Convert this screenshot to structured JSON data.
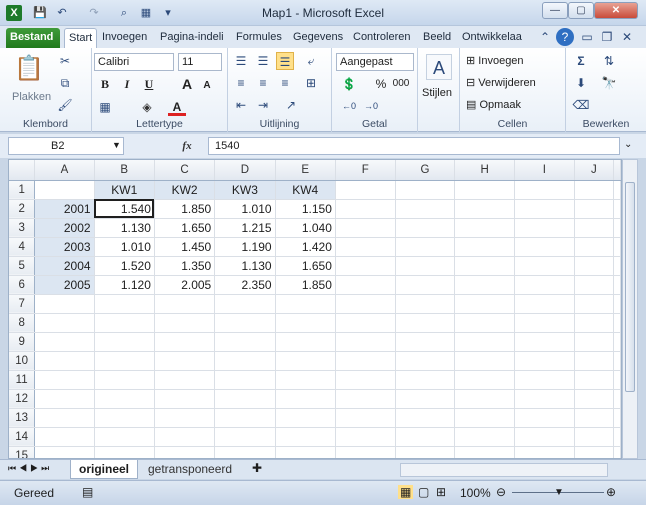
{
  "window": {
    "title": "Map1 - Microsoft Excel"
  },
  "qat": {
    "save": "💾",
    "undo": "↶",
    "redo": "↷"
  },
  "tabs": [
    "Bestand",
    "Start",
    "Invoegen",
    "Pagina-indeli",
    "Formules",
    "Gegevens",
    "Controleren",
    "Beeld",
    "Ontwikkelaa"
  ],
  "ribbon": {
    "clipboard": {
      "paste": "Plakken",
      "label": "Klembord"
    },
    "font": {
      "name": "Calibri",
      "size": "11",
      "label": "Lettertype",
      "bold": "B",
      "italic": "I",
      "underline": "U",
      "grow": "A",
      "shrink": "A"
    },
    "alignment": {
      "label": "Uitlijning"
    },
    "number": {
      "format": "Aangepast",
      "percent": "%",
      "thousands": "000",
      "label": "Getal"
    },
    "styles": {
      "label": "Stijlen"
    },
    "cells": {
      "insert": "Invoegen",
      "delete": "Verwijderen",
      "format": "Opmaak",
      "label": "Cellen"
    },
    "editing": {
      "label": "Bewerken"
    }
  },
  "formula_bar": {
    "name_box": "B2",
    "fx": "fx",
    "value": "1540"
  },
  "grid": {
    "columns": [
      "A",
      "B",
      "C",
      "D",
      "E",
      "F",
      "G",
      "H",
      "I",
      "J"
    ],
    "rows": [
      [
        "",
        "KW1",
        "KW2",
        "KW3",
        "KW4",
        "",
        "",
        "",
        "",
        ""
      ],
      [
        "2001",
        "1.540",
        "1.850",
        "1.010",
        "1.150",
        "",
        "",
        "",
        "",
        ""
      ],
      [
        "2002",
        "1.130",
        "1.650",
        "1.215",
        "1.040",
        "",
        "",
        "",
        "",
        ""
      ],
      [
        "2003",
        "1.010",
        "1.450",
        "1.190",
        "1.420",
        "",
        "",
        "",
        "",
        ""
      ],
      [
        "2004",
        "1.520",
        "1.350",
        "1.130",
        "1.650",
        "",
        "",
        "",
        "",
        ""
      ],
      [
        "2005",
        "1.120",
        "2.005",
        "2.350",
        "1.850",
        "",
        "",
        "",
        "",
        ""
      ],
      [
        "",
        "",
        "",
        "",
        "",
        "",
        "",
        "",
        "",
        ""
      ],
      [
        "",
        "",
        "",
        "",
        "",
        "",
        "",
        "",
        "",
        ""
      ],
      [
        "",
        "",
        "",
        "",
        "",
        "",
        "",
        "",
        "",
        ""
      ],
      [
        "",
        "",
        "",
        "",
        "",
        "",
        "",
        "",
        "",
        ""
      ],
      [
        "",
        "",
        "",
        "",
        "",
        "",
        "",
        "",
        "",
        ""
      ],
      [
        "",
        "",
        "",
        "",
        "",
        "",
        "",
        "",
        "",
        ""
      ],
      [
        "",
        "",
        "",
        "",
        "",
        "",
        "",
        "",
        "",
        ""
      ],
      [
        "",
        "",
        "",
        "",
        "",
        "",
        "",
        "",
        "",
        ""
      ],
      [
        "",
        "",
        "",
        "",
        "",
        "",
        "",
        "",
        "",
        ""
      ]
    ]
  },
  "sheets": [
    "origineel",
    "getransponeerd"
  ],
  "status": {
    "mode": "Gereed",
    "zoom": "100%"
  }
}
